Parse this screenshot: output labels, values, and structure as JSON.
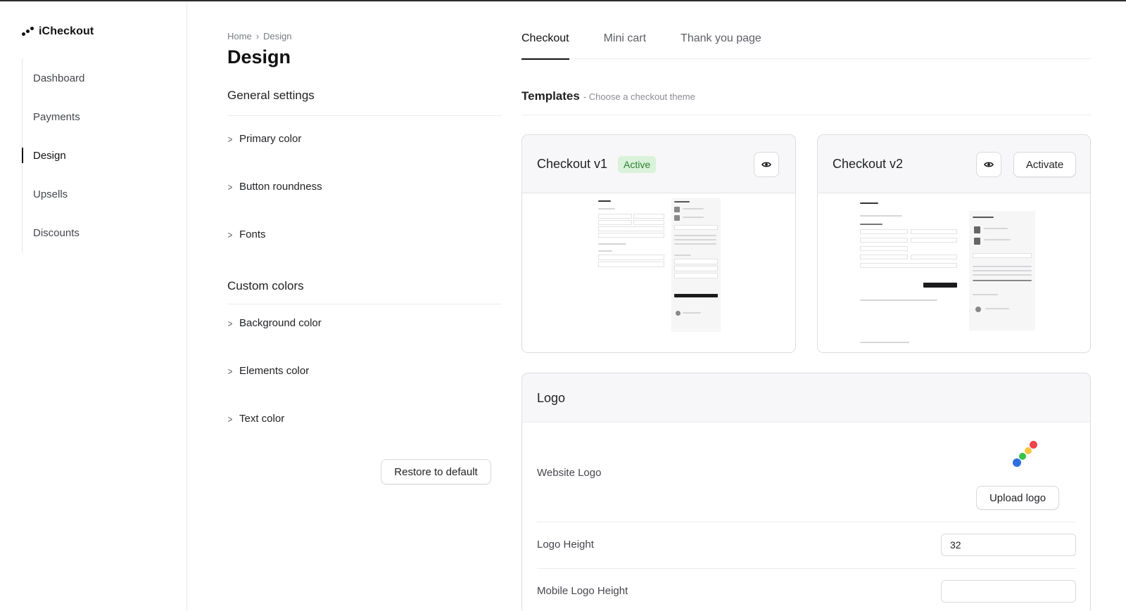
{
  "sidebar": {
    "brand": "iCheckout",
    "items": [
      {
        "label": "Dashboard",
        "active": false
      },
      {
        "label": "Payments",
        "active": false
      },
      {
        "label": "Design",
        "active": true
      },
      {
        "label": "Upsells",
        "active": false
      },
      {
        "label": "Discounts",
        "active": false
      }
    ]
  },
  "breadcrumb": {
    "home": "Home",
    "separator": "›",
    "current": "Design"
  },
  "page_title": "Design",
  "general_settings": {
    "title": "General settings",
    "items": [
      "Primary color",
      "Button roundness",
      "Fonts"
    ]
  },
  "custom_colors": {
    "title": "Custom colors",
    "items": [
      "Background color",
      "Elements color",
      "Text color"
    ]
  },
  "restore_button": "Restore to default",
  "tabs": [
    {
      "label": "Checkout",
      "active": true
    },
    {
      "label": "Mini cart",
      "active": false
    },
    {
      "label": "Thank you page",
      "active": false
    }
  ],
  "templates": {
    "title": "Templates",
    "subtitle": "- Choose a checkout theme",
    "cards": [
      {
        "title": "Checkout v1",
        "badge": "Active",
        "preview_icon": "eye-icon"
      },
      {
        "title": "Checkout v2",
        "action": "Activate",
        "preview_icon": "eye-icon"
      }
    ]
  },
  "logo": {
    "title": "Logo",
    "website_logo_label": "Website Logo",
    "upload_button": "Upload logo",
    "logo_height_label": "Logo Height",
    "logo_height_value": "32",
    "mobile_logo_height_label": "Mobile Logo Height",
    "mobile_logo_height_value": ""
  },
  "colors": {
    "accent": "#111111",
    "active_badge_bg": "#d9f2d9",
    "active_badge_text": "#2e7d32"
  }
}
